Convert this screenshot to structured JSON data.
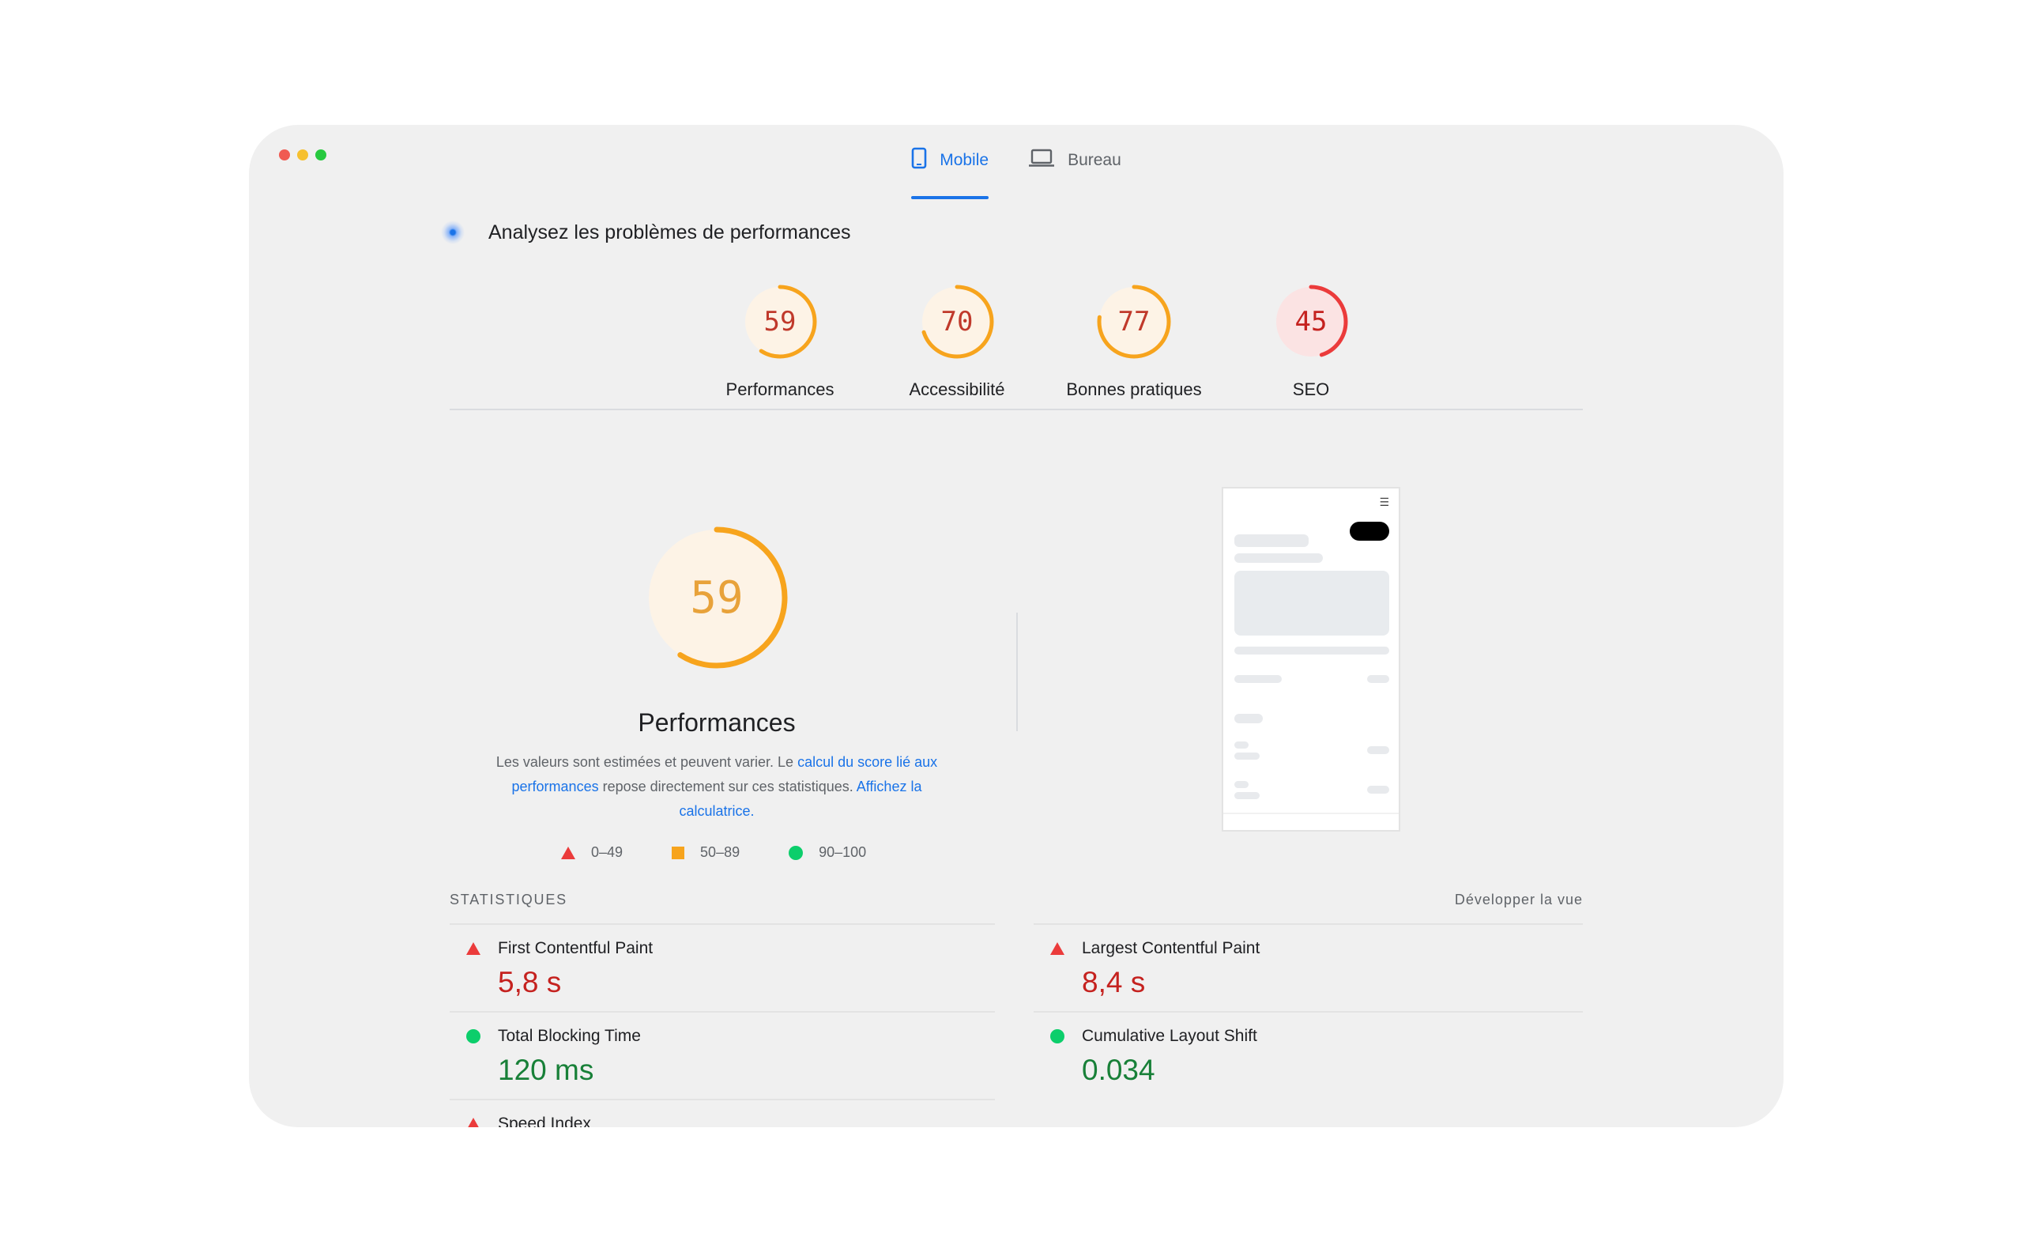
{
  "tabs": [
    {
      "label": "Mobile",
      "icon": "smartphone-icon",
      "active": true
    },
    {
      "label": "Bureau",
      "icon": "laptop-icon",
      "active": false
    }
  ],
  "analyze": {
    "label": "Analysez les problèmes de performances"
  },
  "categories": [
    {
      "label": "Performances",
      "score": 59,
      "color": "#f7a41d",
      "text_color": "#c0392b"
    },
    {
      "label": "Accessibilité",
      "score": 70,
      "color": "#f7a41d",
      "text_color": "#c0392b"
    },
    {
      "label": "Bonnes pratiques",
      "score": 77,
      "color": "#f7a41d",
      "text_color": "#c0392b"
    },
    {
      "label": "SEO",
      "score": 45,
      "color": "#eb3b3b",
      "text_color": "#c5221f"
    }
  ],
  "main": {
    "score": 59,
    "title": "Performances",
    "desc_prefix": "Les valeurs sont estimées et peuvent varier. Le ",
    "desc_link1": "calcul du score lié aux performances",
    "desc_middle": " repose directement sur ces statistiques. ",
    "desc_link2": "Affichez la calculatrice."
  },
  "legend": [
    {
      "label": "0–49",
      "shape": "triangle",
      "color": "#eb3b3b"
    },
    {
      "label": "50–89",
      "shape": "square",
      "color": "#f7a41d"
    },
    {
      "label": "90–100",
      "shape": "circle",
      "color": "#0cce6b"
    }
  ],
  "stats": {
    "heading": "STATISTIQUES",
    "expand": "Développer la vue",
    "metrics": [
      {
        "label": "First Contentful Paint",
        "value": "5,8 s",
        "status": "red"
      },
      {
        "label": "Largest Contentful Paint",
        "value": "8,4 s",
        "status": "red"
      },
      {
        "label": "Total Blocking Time",
        "value": "120 ms",
        "status": "green"
      },
      {
        "label": "Cumulative Layout Shift",
        "value": "0.034",
        "status": "green"
      },
      {
        "label": "Speed Index",
        "value": "",
        "status": "red"
      }
    ]
  },
  "colors": {
    "accent": "#1a73e8",
    "average": "#f7a41d",
    "fail": "#eb3b3b",
    "pass": "#0cce6b"
  }
}
